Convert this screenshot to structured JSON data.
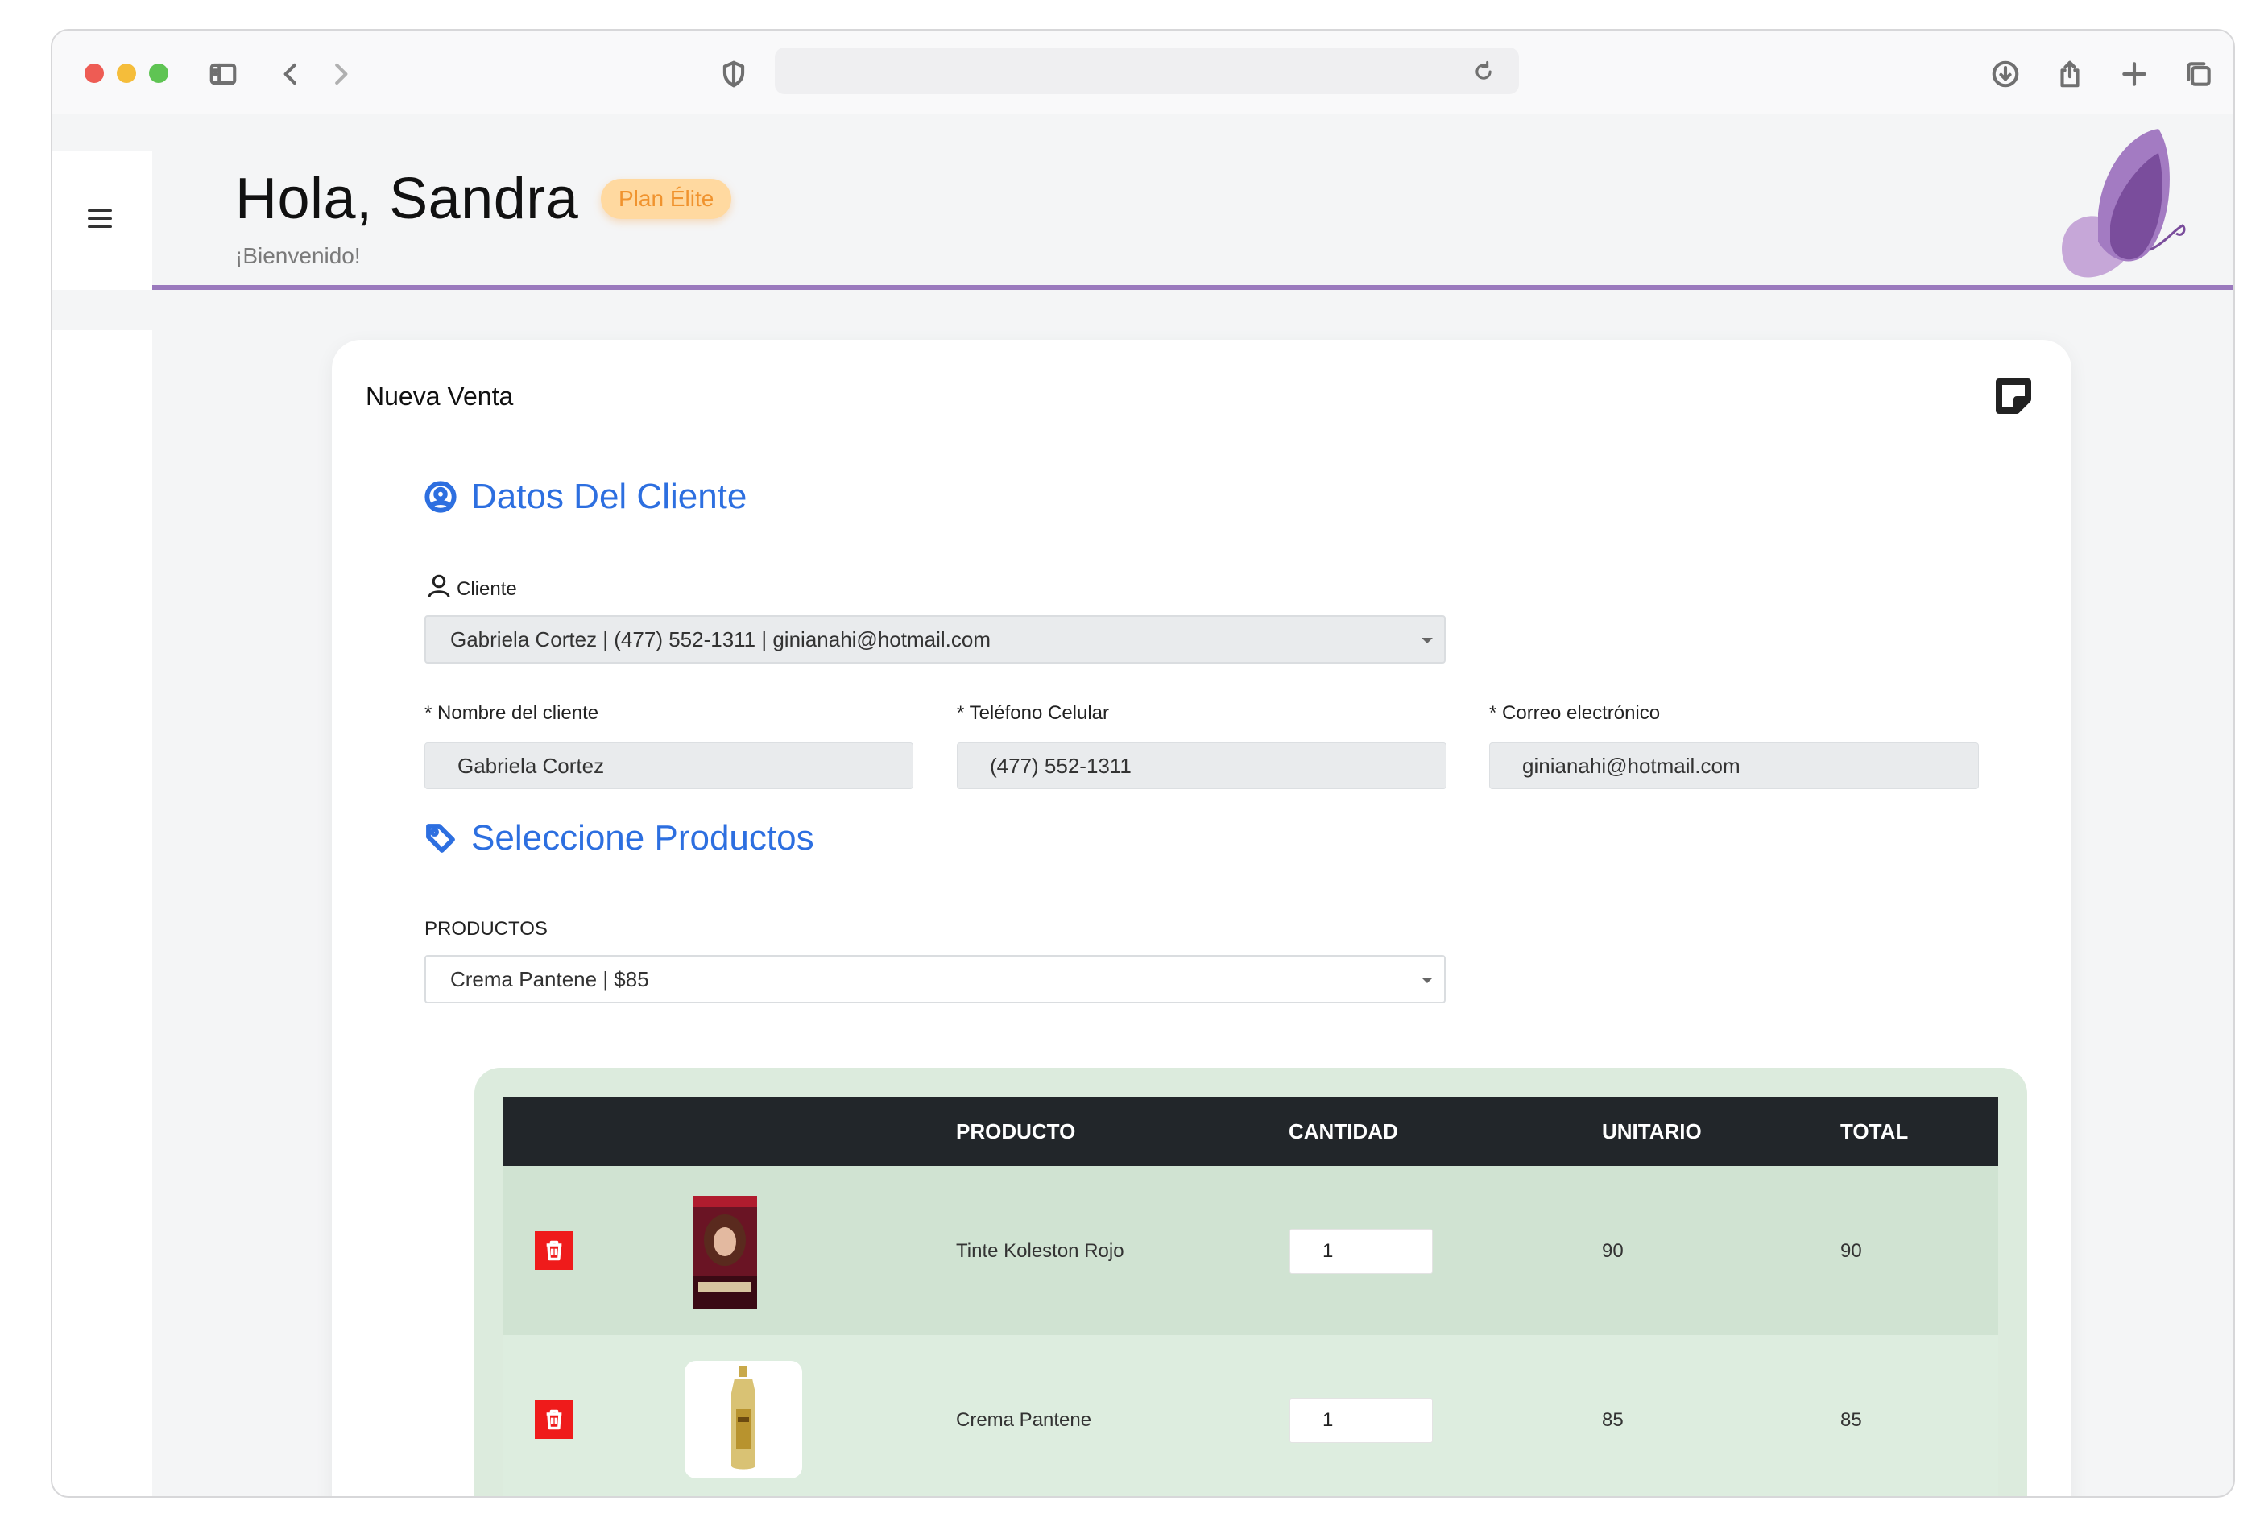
{
  "browser": {
    "url": "",
    "icons": [
      "sidebar-toggle-icon",
      "back-icon",
      "forward-icon",
      "shield-icon",
      "reload-icon",
      "download-icon",
      "share-icon",
      "new-tab-icon",
      "tabs-overview-icon"
    ]
  },
  "header": {
    "greeting": "Hola, Sandra",
    "plan_badge": "Plan Élite",
    "welcome": "¡Bienvenido!",
    "accent_color": "#9a79bd"
  },
  "card": {
    "title": "Nueva Venta"
  },
  "client_section": {
    "title": "Datos Del Cliente",
    "client_label": "Cliente",
    "client_select_value": "Gabriela Cortez | (477) 552-1311 | ginianahi@hotmail.com",
    "name_label": "* Nombre del cliente",
    "name_value": "Gabriela Cortez",
    "phone_label": "* Teléfono Celular",
    "phone_value": "(477) 552-1311",
    "email_label": "* Correo electrónico",
    "email_value": "ginianahi@hotmail.com"
  },
  "products_section": {
    "title": "Seleccione Productos",
    "products_label": "PRODUCTOS",
    "product_select_value": "Crema Pantene | $85"
  },
  "table": {
    "headers": [
      "PRODUCTO",
      "CANTIDAD",
      "UNITARIO",
      "TOTAL"
    ],
    "rows": [
      {
        "product": "Tinte Koleston Rojo",
        "quantity": "1",
        "unit": "90",
        "total": "90"
      },
      {
        "product": "Crema Pantene",
        "quantity": "1",
        "unit": "85",
        "total": "85"
      }
    ]
  },
  "colors": {
    "primary_blue": "#2d6fe0",
    "badge_bg": "#ffd9a0",
    "badge_text": "#f0932e",
    "table_header": "#22262a",
    "table_bg": "#dcebdd",
    "delete_red": "#ef1b1b"
  }
}
